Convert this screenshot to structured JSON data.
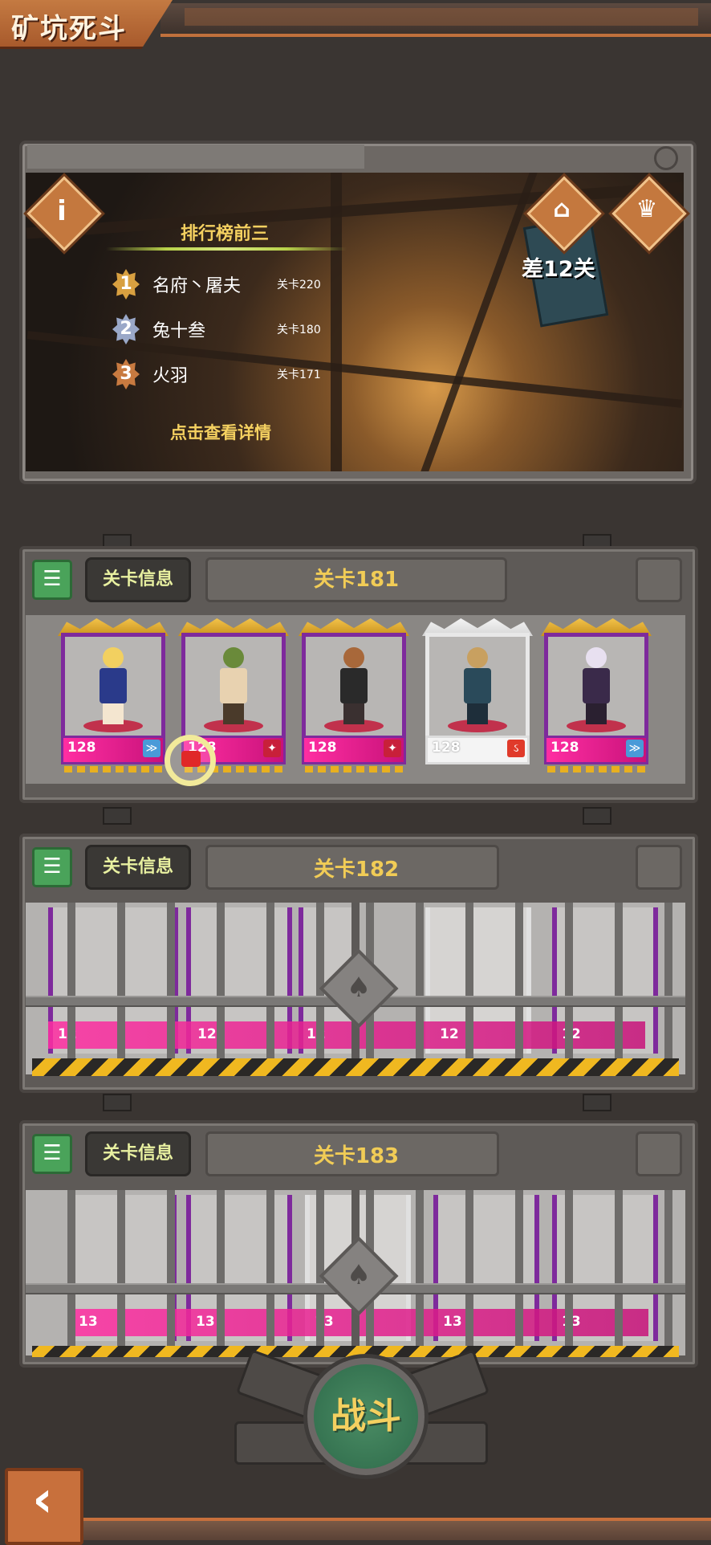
{
  "header": {
    "title": "矿坑死斗"
  },
  "leaderboard": {
    "heading": "排行榜前三",
    "entries": [
      {
        "rank": "1",
        "name": "名府丶屠夫",
        "level": "关卡220",
        "color": "#d8a040"
      },
      {
        "rank": "2",
        "name": "兔十叁",
        "level": "关卡180",
        "color": "#9aa8c8"
      },
      {
        "rank": "3",
        "name": "火羽",
        "level": "关卡171",
        "color": "#c87a40"
      }
    ],
    "detail_link": "点击查看详情",
    "gap_text": "差12关",
    "icons": {
      "info": "info-icon",
      "gift": "gift-icon",
      "trophy": "trophy-icon"
    }
  },
  "stages": [
    {
      "info_label": "关卡信息",
      "name": "关卡181",
      "locked": false,
      "heroes": [
        {
          "level": "128",
          "rarity": "purple",
          "type_color": "#4a9ad8"
        },
        {
          "level": "128",
          "rarity": "purple",
          "type_color": "#c8203a"
        },
        {
          "level": "128",
          "rarity": "purple",
          "type_color": "#c8203a"
        },
        {
          "level": "128",
          "rarity": "white",
          "type_color": "#e03a2a"
        },
        {
          "level": "128",
          "rarity": "purple",
          "type_color": "#4a9ad8"
        }
      ]
    },
    {
      "info_label": "关卡信息",
      "name": "关卡182",
      "locked": true,
      "heroes": [
        {
          "level": "12",
          "rarity": "purple"
        },
        {
          "level": "12",
          "rarity": "purple"
        },
        {
          "level": "12",
          "rarity": "purple"
        },
        {
          "level": "12",
          "rarity": "white"
        },
        {
          "level": "12",
          "rarity": "purple"
        }
      ]
    },
    {
      "info_label": "关卡信息",
      "name": "关卡183",
      "locked": true,
      "heroes": [
        {
          "level": "13",
          "rarity": "purple"
        },
        {
          "level": "13",
          "rarity": "purple"
        },
        {
          "level": "13",
          "rarity": "white"
        },
        {
          "level": "13",
          "rarity": "purple"
        },
        {
          "level": "13",
          "rarity": "purple"
        }
      ]
    }
  ],
  "fight_button": {
    "label": "战斗"
  },
  "back_button": {
    "glyph": "‹",
    "icon": "back-arrow-icon"
  }
}
